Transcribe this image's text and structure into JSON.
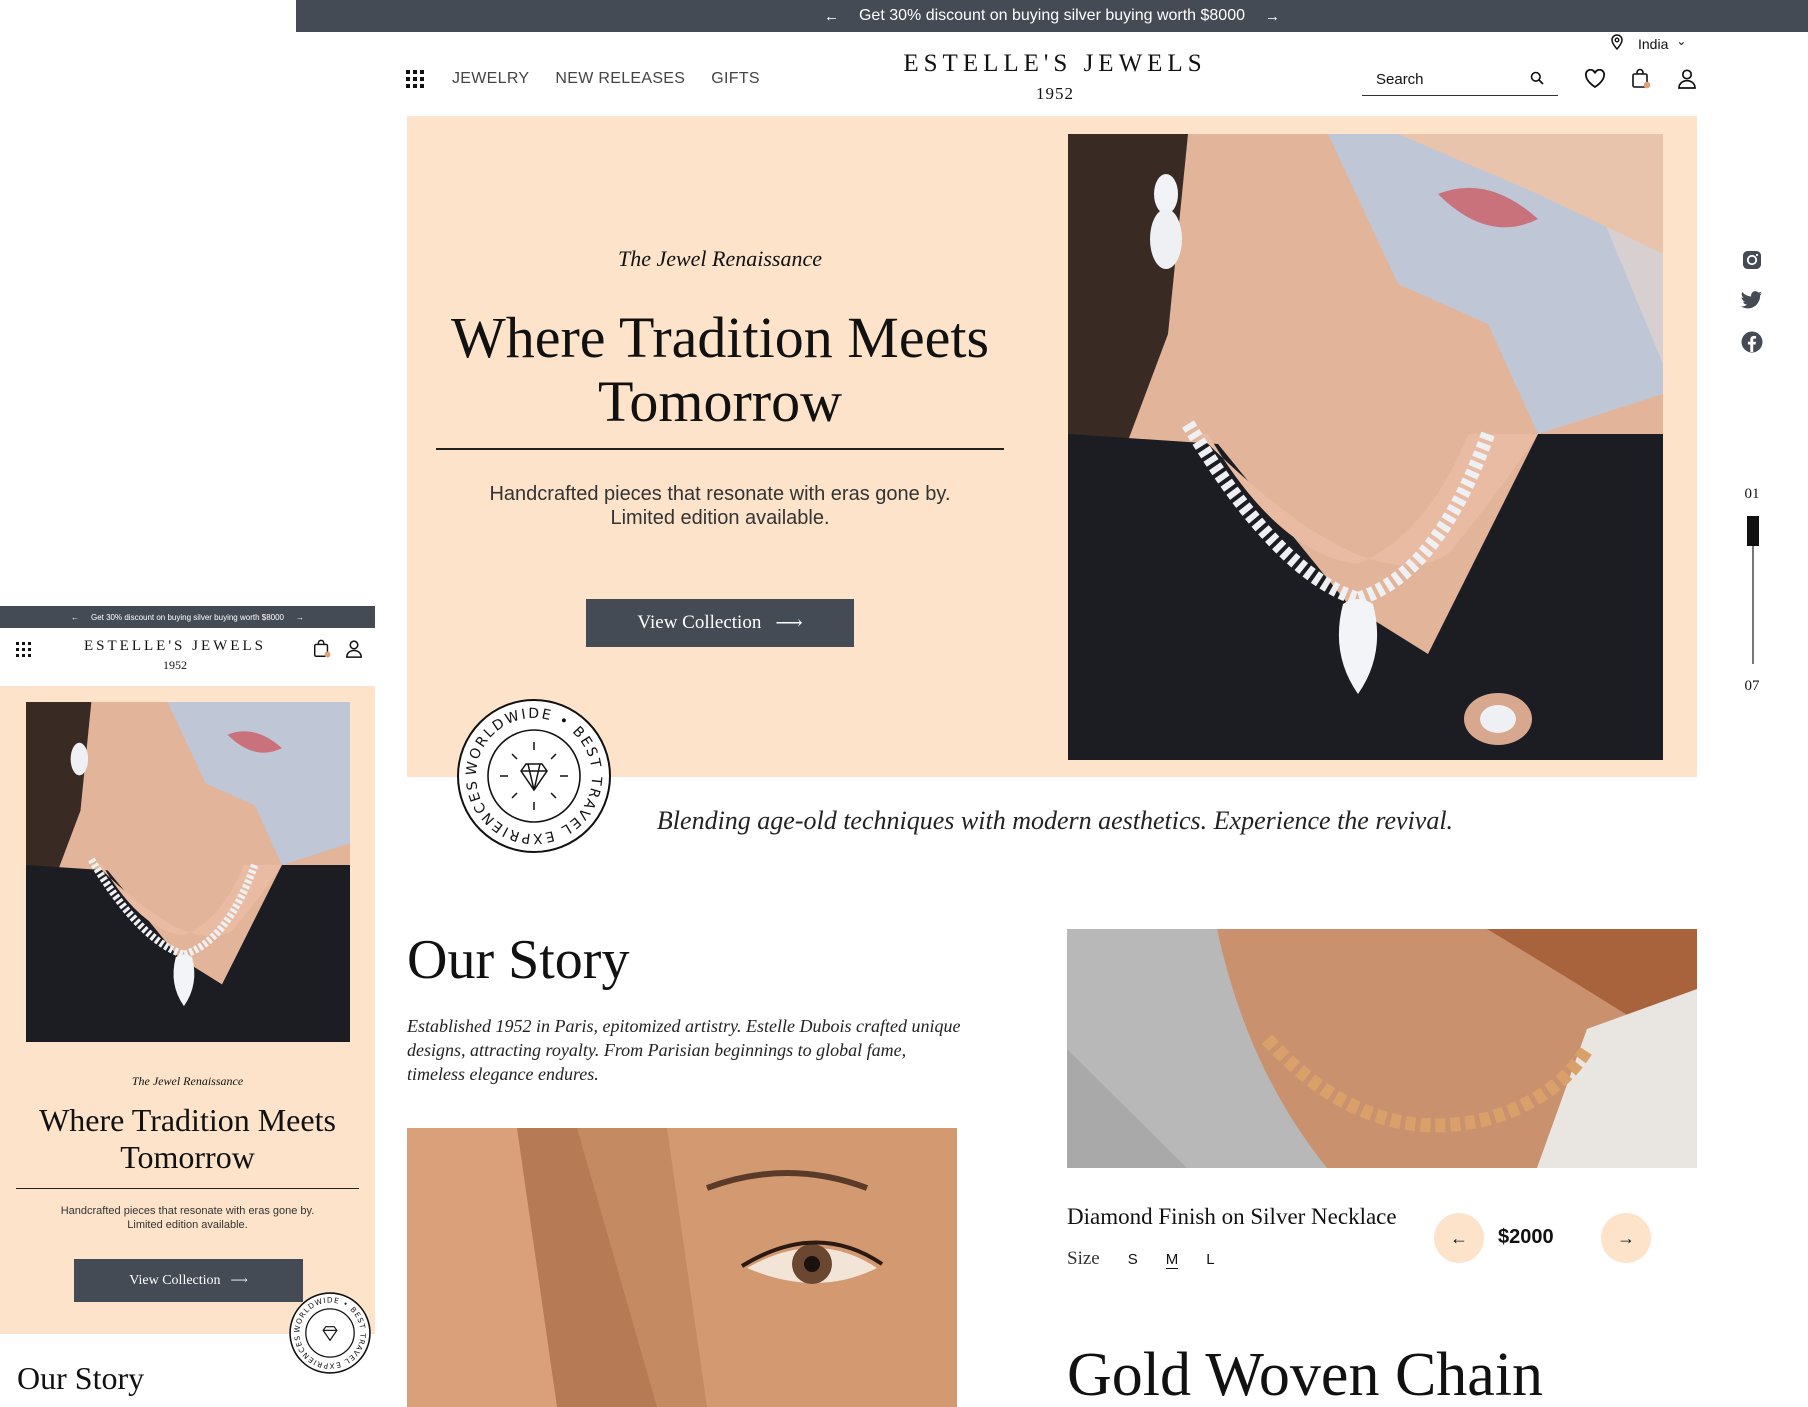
{
  "promo": {
    "text": "Get 30% discount on buying silver buying worth $8000",
    "prev_arrow": "←",
    "next_arrow": "→"
  },
  "country": {
    "label": "India",
    "chevron": "⌄"
  },
  "nav": {
    "items": [
      "JEWELRY",
      "NEW RELEASES",
      "GIFTS"
    ]
  },
  "brand": {
    "name": "ESTELLE'S JEWELS",
    "year": "1952"
  },
  "search": {
    "placeholder": "Search"
  },
  "header_icons": [
    "heart-icon",
    "bag-icon",
    "user-icon"
  ],
  "hero": {
    "subtitle": "The Jewel Renaissance",
    "title": "Where Tradition Meets Tomorrow",
    "description_line1": "Handcrafted pieces that resonate with eras gone by.",
    "description_line2": "Limited edition available.",
    "cta_label": "View Collection",
    "cta_arrow": "⟶",
    "background": "#fde3ca"
  },
  "badge": {
    "ring_text": "WORLDWIDE • BEST TRAVEL EXPRIENCES •"
  },
  "social": [
    "instagram-icon",
    "twitter-icon",
    "facebook-icon"
  ],
  "pager": {
    "current": "01",
    "total": "07",
    "progress": 0.14
  },
  "tagline": "Blending age-old techniques with modern aesthetics. Experience the revival.",
  "story": {
    "title": "Our Story",
    "text": "Established 1952 in Paris, epitomized artistry. Estelle Dubois crafted unique designs, attracting royalty. From Parisian beginnings to global fame, timeless elegance endures."
  },
  "product": {
    "name": "Diamond Finish on Silver Necklace",
    "size_label": "Size",
    "sizes": [
      "S",
      "M",
      "L"
    ],
    "selected_size": "M",
    "price": "$2000",
    "prev": "←",
    "next": "→"
  },
  "next_product": {
    "title": "Gold Woven Chain"
  },
  "colors": {
    "dark": "#454b55",
    "peach": "#fde3ca",
    "accent_dot": "#e0a07a"
  }
}
